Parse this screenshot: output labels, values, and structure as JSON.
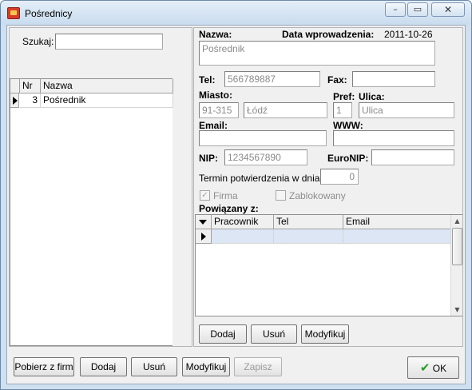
{
  "window": {
    "title": "Pośrednicy",
    "minimize_glyph": "–",
    "maximize_glyph": "▭",
    "close_glyph": "✕"
  },
  "search": {
    "label": "Szukaj:",
    "value": ""
  },
  "list": {
    "columns": [
      "Nr",
      "Nazwa"
    ],
    "rows": [
      {
        "nr": "3",
        "nazwa": "Pośrednik"
      }
    ]
  },
  "form": {
    "nazwa_label": "Nazwa:",
    "nazwa_value": "Pośrednik",
    "data_label": "Data wprowadzenia:",
    "data_value": "2011-10-26",
    "tel_label": "Tel:",
    "tel_value": "566789887",
    "fax_label": "Fax:",
    "fax_value": "",
    "miasto_label": "Miasto:",
    "kod_value": "91-315",
    "miasto_value": "Łódź",
    "pref_label": "Pref:",
    "pref_value": "1",
    "ulica_label": "Ulica:",
    "ulica_value": "Ulica",
    "email_label": "Email:",
    "email_value": "",
    "www_label": "WWW:",
    "www_value": "",
    "nip_label": "NIP:",
    "nip_value": "1234567890",
    "euronip_label": "EuroNIP:",
    "euronip_value": "",
    "termin_label": "Termin potwierdzenia w dniach:",
    "termin_value": "0",
    "firma_label": "Firma",
    "firma_checked": true,
    "zablokowany_label": "Zablokowany",
    "zablokowany_checked": false,
    "powiazany_label": "Powiązany z:"
  },
  "linked_grid": {
    "columns": [
      "Pracownik",
      "Tel",
      "Email"
    ]
  },
  "inner_buttons": {
    "dodaj": "Dodaj",
    "usun": "Usuń",
    "modyfikuj": "Modyfikuj"
  },
  "bottom_buttons": {
    "pobierz": "Pobierz z firm",
    "dodaj": "Dodaj",
    "usun": "Usuń",
    "modyfikuj": "Modyfikuj",
    "zapisz": "Zapisz",
    "ok": "OK"
  },
  "colors": {
    "selected_row": "#dce6f4",
    "ok_check": "#2a9a2a"
  }
}
